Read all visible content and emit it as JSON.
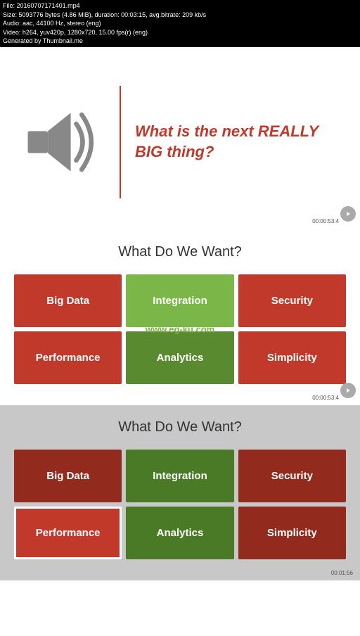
{
  "fileInfo": {
    "line1": "File: 20160707171401.mp4",
    "line2": "Size: 5093776 bytes (4.86 MiB), duration: 00:03:15, avg.bitrate: 209 kb/s",
    "line3": "Audio: aac, 44100 Hz, stereo (eng)",
    "line4": "Video: h264, yuv420p, 1280x720, 15.00 fps(r) (eng)",
    "line5": "Generated by Thumbnail.me"
  },
  "hero": {
    "question": "What is the next REALLY BIG thing?"
  },
  "section1": {
    "title": "What Do We Want?",
    "tiles": [
      {
        "label": "Big Data",
        "type": "red"
      },
      {
        "label": "Integration",
        "type": "green"
      },
      {
        "label": "Security",
        "type": "red"
      },
      {
        "label": "Performance",
        "type": "red"
      },
      {
        "label": "Analytics",
        "type": "dark-green"
      },
      {
        "label": "Simplicity",
        "type": "red"
      }
    ],
    "timestamp": "00:00:53:4",
    "watermark": "www.eg-ku.com"
  },
  "section2": {
    "title": "What Do We Want?",
    "tiles": [
      {
        "label": "Big Data",
        "type": "dark-red"
      },
      {
        "label": "Integration",
        "type": "dark-green2"
      },
      {
        "label": "Security",
        "type": "dark-red"
      },
      {
        "label": "Performance",
        "type": "perf-outline"
      },
      {
        "label": "Analytics",
        "type": "dark-green2"
      },
      {
        "label": "Simplicity",
        "type": "dark-red"
      }
    ],
    "timestamp": "00:01:56"
  }
}
